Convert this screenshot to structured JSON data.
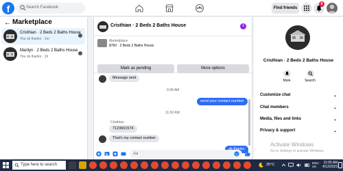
{
  "topnav": {
    "logo": "f",
    "search_placeholder": "Search Facebook",
    "find_friends": "Find friends",
    "notif_count": "6"
  },
  "left": {
    "back": "←",
    "title": "Marketplace",
    "conversations": [
      {
        "name": "Cristhian · 2 Beds 2 Baths House",
        "sub": "You ok thanks · 1m"
      },
      {
        "name": "Marilyn · 2 Beds 2 Baths House",
        "sub": "You ok thanks · 1h"
      }
    ]
  },
  "chat": {
    "title": "Cristhian · 2 Beds 2 Baths House",
    "info_icon": "i",
    "marketplace_label": "Marketplace",
    "listing": "$760 · 2 Beds 2 Baths House",
    "mark_pending": "Mark as pending",
    "more_options": "More options",
    "messages": {
      "m1": "Message sent",
      "t1": "9:28 AM",
      "m2": "send your contact number",
      "t2": "11:02 AM",
      "sender": "Cristhian",
      "m3": "7123601574",
      "m4": "That's my contact number",
      "m5": "ok thanks"
    },
    "composer_placeholder": "Aa"
  },
  "right": {
    "name": "Cristhian · 2 Beds 2 Baths House",
    "mute": "Mute",
    "search": "Search",
    "rows": [
      "Customize chat",
      "Chat members",
      "Media, files and links",
      "Privacy & support"
    ],
    "watermark_title": "Activate Windows",
    "watermark_sub": "Go to Settings to activate Windows."
  },
  "taskbar": {
    "search": "Type here to search",
    "temp": "25°C",
    "lang1": "ENG",
    "lang2": "UK",
    "time": "11:05 AM",
    "date": "4/12/2023"
  },
  "colors": {
    "accent": "#1877f2",
    "outgoing": "#2e6cf6",
    "taskbar": "#1f2a44"
  }
}
